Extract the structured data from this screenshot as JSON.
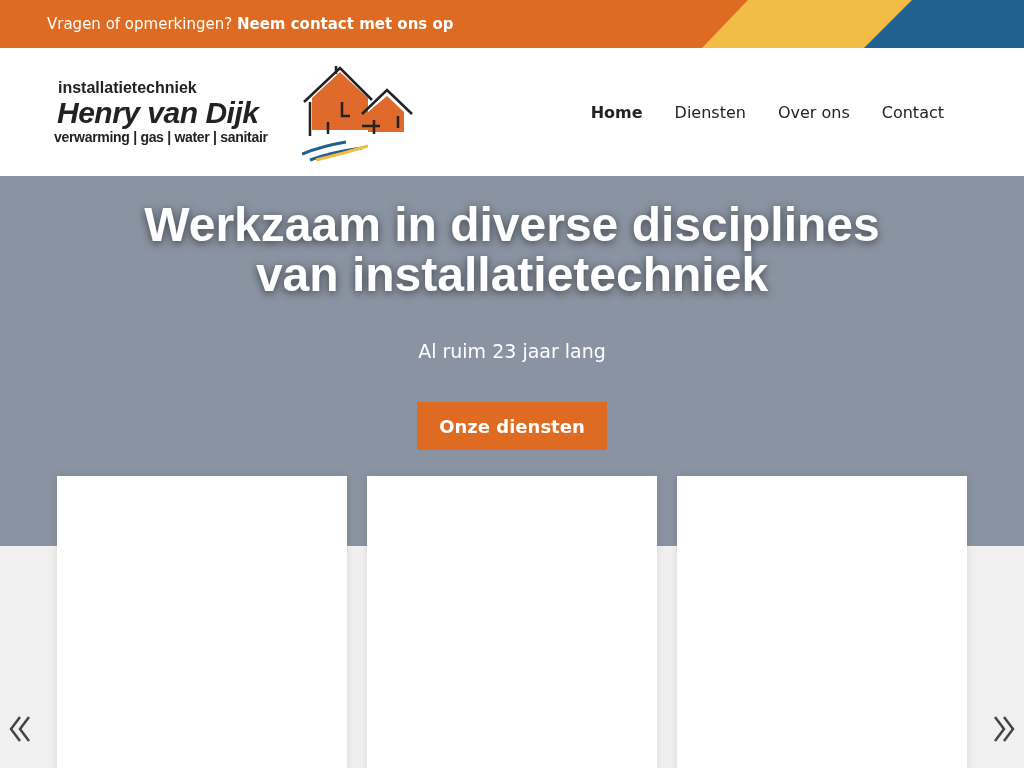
{
  "top_bar": {
    "text": "Vragen of opmerkingen? **Neem contact met ons op**"
  },
  "logo": {
    "tagline": "installatietechniek",
    "name": "Henry van Dijk",
    "services": "verwarming | gas | water | sanitair"
  },
  "nav": [
    {
      "label": "Home",
      "selected": true
    },
    {
      "label": "Diensten",
      "selected": false
    },
    {
      "label": "Over ons",
      "selected": false
    },
    {
      "label": "Contact",
      "selected": false
    }
  ],
  "hero": {
    "title": "Werkzaam in diverse disciplines van installatietechniek",
    "subtitle": "Al ruim 23 jaar lang",
    "button": "Onze diensten"
  },
  "cards": [
    {
      "kind": "blank"
    },
    {
      "kind": "blank"
    },
    {
      "kind": "blank"
    }
  ]
}
